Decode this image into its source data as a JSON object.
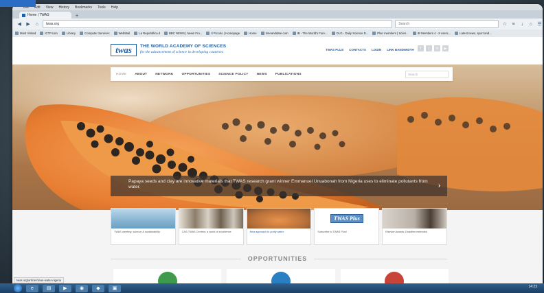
{
  "browser": {
    "menu": [
      "File",
      "Edit",
      "View",
      "History",
      "Bookmarks",
      "Tools",
      "Help"
    ],
    "tab_title": "Home | TWAS",
    "url": "twas.org",
    "search_placeholder": "Search",
    "bookmarks": [
      "Most Visited",
      "ICTP.com",
      "Library",
      "Computer Services",
      "WebMail",
      "La Repubblica.it",
      "BBC NEWS | News Fro...",
      "Il Piccolo | Homepage",
      "Home",
      "timeanddate.com",
      "IB - The World's Fore...",
      "DLG - Daily Science D...",
      "Plan members | Scien...",
      "IB Members 4 - 8 users...",
      "Latest news, sport and..."
    ]
  },
  "site": {
    "logo": "twas",
    "title": "THE WORLD ACADEMY OF SCIENCES",
    "subtitle": "for the advancement of science in developing countries",
    "top_links": [
      "TWAS PLUS",
      "CONTACTS",
      "LOGIN",
      "LINK BANDWIDTH"
    ],
    "nav": [
      "HOME",
      "ABOUT",
      "NETWORK",
      "OPPORTUNITIES",
      "SCIENCE POLICY",
      "NEWS",
      "PUBLICATIONS"
    ],
    "nav_search_placeholder": "Search",
    "hero_caption": "Papaya seeds and clay are innovative materials that TWAS research grant winner Emmanuel Unuabonah from Nigeria uses to eliminate pollutants from water.",
    "cards": [
      {
        "text": "TWAS meeting: science & sustainability",
        "color": "#6a9fc2"
      },
      {
        "text": "CAS-TWAS Centres: a world of excellence",
        "color": "#8b7d6a"
      },
      {
        "text": "New approach to purify water",
        "color": "#d4935a"
      },
      {
        "text": "Subscribe to TWAS Plus!",
        "color": "#ffffff"
      },
      {
        "text": "Elsevier Awards: Deadline extended",
        "color": "#b9b0a6"
      }
    ],
    "twas_plus_badge": "TWAS Plus",
    "opportunities_title": "OPPORTUNITIES",
    "opportunity_icon_colors": [
      "#3f9a4b",
      "#2a7fc2",
      "#c84438"
    ]
  },
  "status_link": "twas.org/article/clean-water-nigeria",
  "taskbar": {
    "clock": "14:23"
  },
  "colors": {
    "brand": "#1f5fa8"
  }
}
